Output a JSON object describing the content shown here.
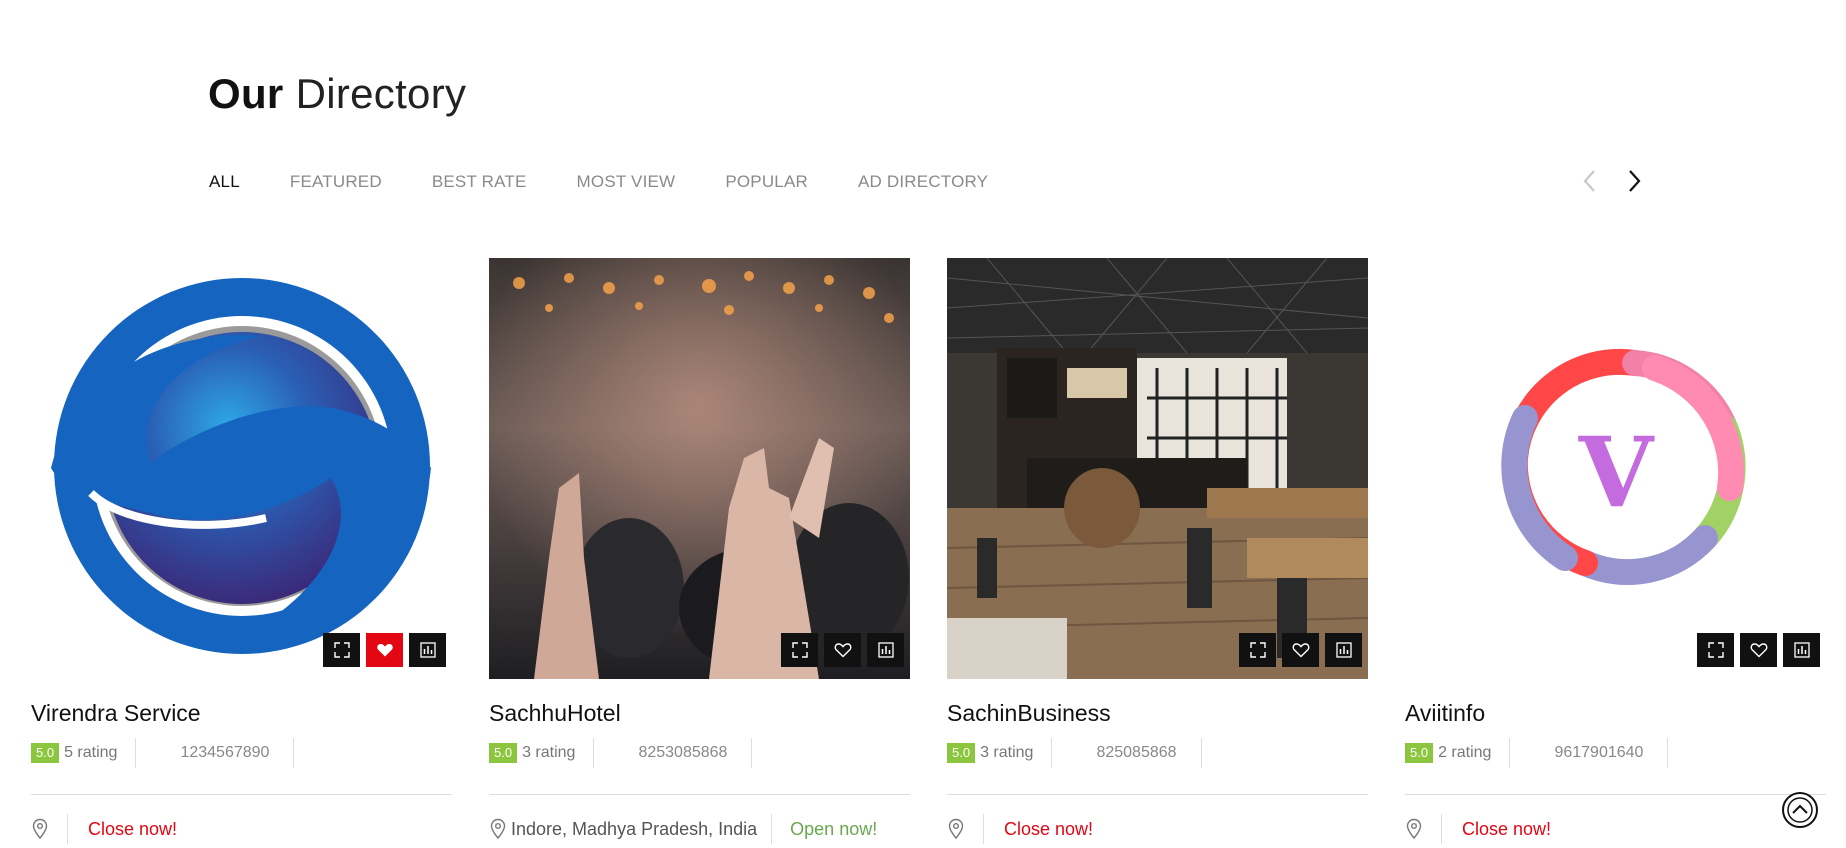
{
  "section": {
    "title_bold": "Our",
    "title_rest": "Directory"
  },
  "tabs": [
    {
      "label": "ALL",
      "active": true
    },
    {
      "label": "FEATURED",
      "active": false
    },
    {
      "label": "BEST RATE",
      "active": false
    },
    {
      "label": "MOST VIEW",
      "active": false
    },
    {
      "label": "POPULAR",
      "active": false
    },
    {
      "label": "AD DIRECTORY",
      "active": false
    }
  ],
  "nav": {
    "prev_icon": "chevron-left-icon",
    "next_icon": "chevron-right-icon"
  },
  "colors": {
    "badge": "#8cc63f",
    "open": "#6aa84f",
    "closed": "#e30613",
    "favorite_active": "#e30613",
    "action_bg": "#111111"
  },
  "cards": [
    {
      "name": "Virendra Service",
      "badge": "5.0",
      "rating": "5 rating",
      "phone": "1234567890",
      "location": "",
      "status": "Close now!",
      "open": false,
      "favorited": true,
      "image": "blue-s-logo"
    },
    {
      "name": "SachhuHotel",
      "badge": "5.0",
      "rating": "3 rating",
      "phone": "8253085868",
      "location": "Indore, Madhya Pradesh, India",
      "status": "Open now!",
      "open": true,
      "favorited": false,
      "image": "concert-crowd-photo"
    },
    {
      "name": "SachinBusiness",
      "badge": "5.0",
      "rating": "3 rating",
      "phone": "825085868",
      "location": "",
      "status": "Close now!",
      "open": false,
      "favorited": false,
      "image": "cafe-interior-photo"
    },
    {
      "name": "Aviitinfo",
      "badge": "5.0",
      "rating": "2 rating",
      "phone": "9617901640",
      "location": "",
      "status": "Close now!",
      "open": false,
      "favorited": false,
      "image": "v-logo"
    }
  ],
  "scroll_top_icon": "chevron-up-circle-icon"
}
